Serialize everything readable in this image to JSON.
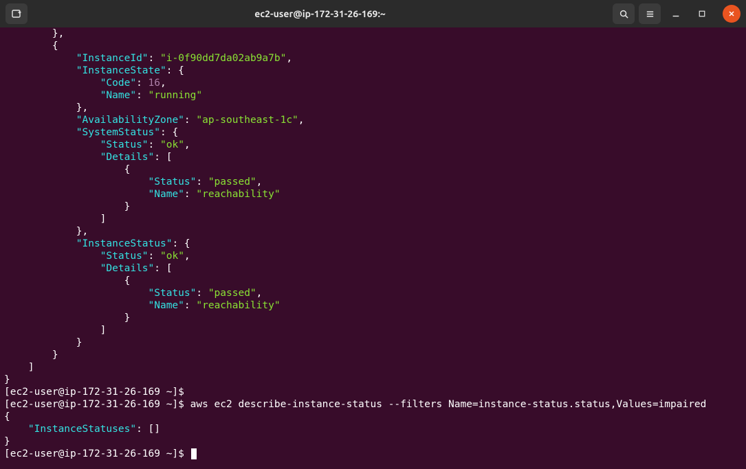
{
  "window": {
    "title": "ec2-user@ip-172-31-26-169:~"
  },
  "icons": {
    "new_tab": "new-tab-icon",
    "search": "search-icon",
    "menu": "hamburger-icon",
    "minimize": "minimize-icon",
    "maximize": "maximize-icon",
    "close": "close-icon"
  },
  "terminal": {
    "json_fragment": {
      "instance_id_key": "\"InstanceId\"",
      "instance_id_val": "\"i-0f90dd7da02ab9a7b\"",
      "instance_state_key": "\"InstanceState\"",
      "code_key": "\"Code\"",
      "code_val": "16",
      "name_key": "\"Name\"",
      "running_val": "\"running\"",
      "az_key": "\"AvailabilityZone\"",
      "az_val": "\"ap-southeast-1c\"",
      "system_status_key": "\"SystemStatus\"",
      "status_key": "\"Status\"",
      "ok_val": "\"ok\"",
      "details_key": "\"Details\"",
      "passed_val": "\"passed\"",
      "reachability_val": "\"reachability\"",
      "instance_status_key": "\"InstanceStatus\"",
      "inst_statuses_key": "\"InstanceStatuses\""
    },
    "prompt1": "[ec2-user@ip-172-31-26-169 ~]$ ",
    "prompt2": "[ec2-user@ip-172-31-26-169 ~]$ ",
    "command": "aws ec2 describe-instance-status --filters Name=instance-status.status,Values=impaired",
    "prompt3": "[ec2-user@ip-172-31-26-169 ~]$ "
  }
}
